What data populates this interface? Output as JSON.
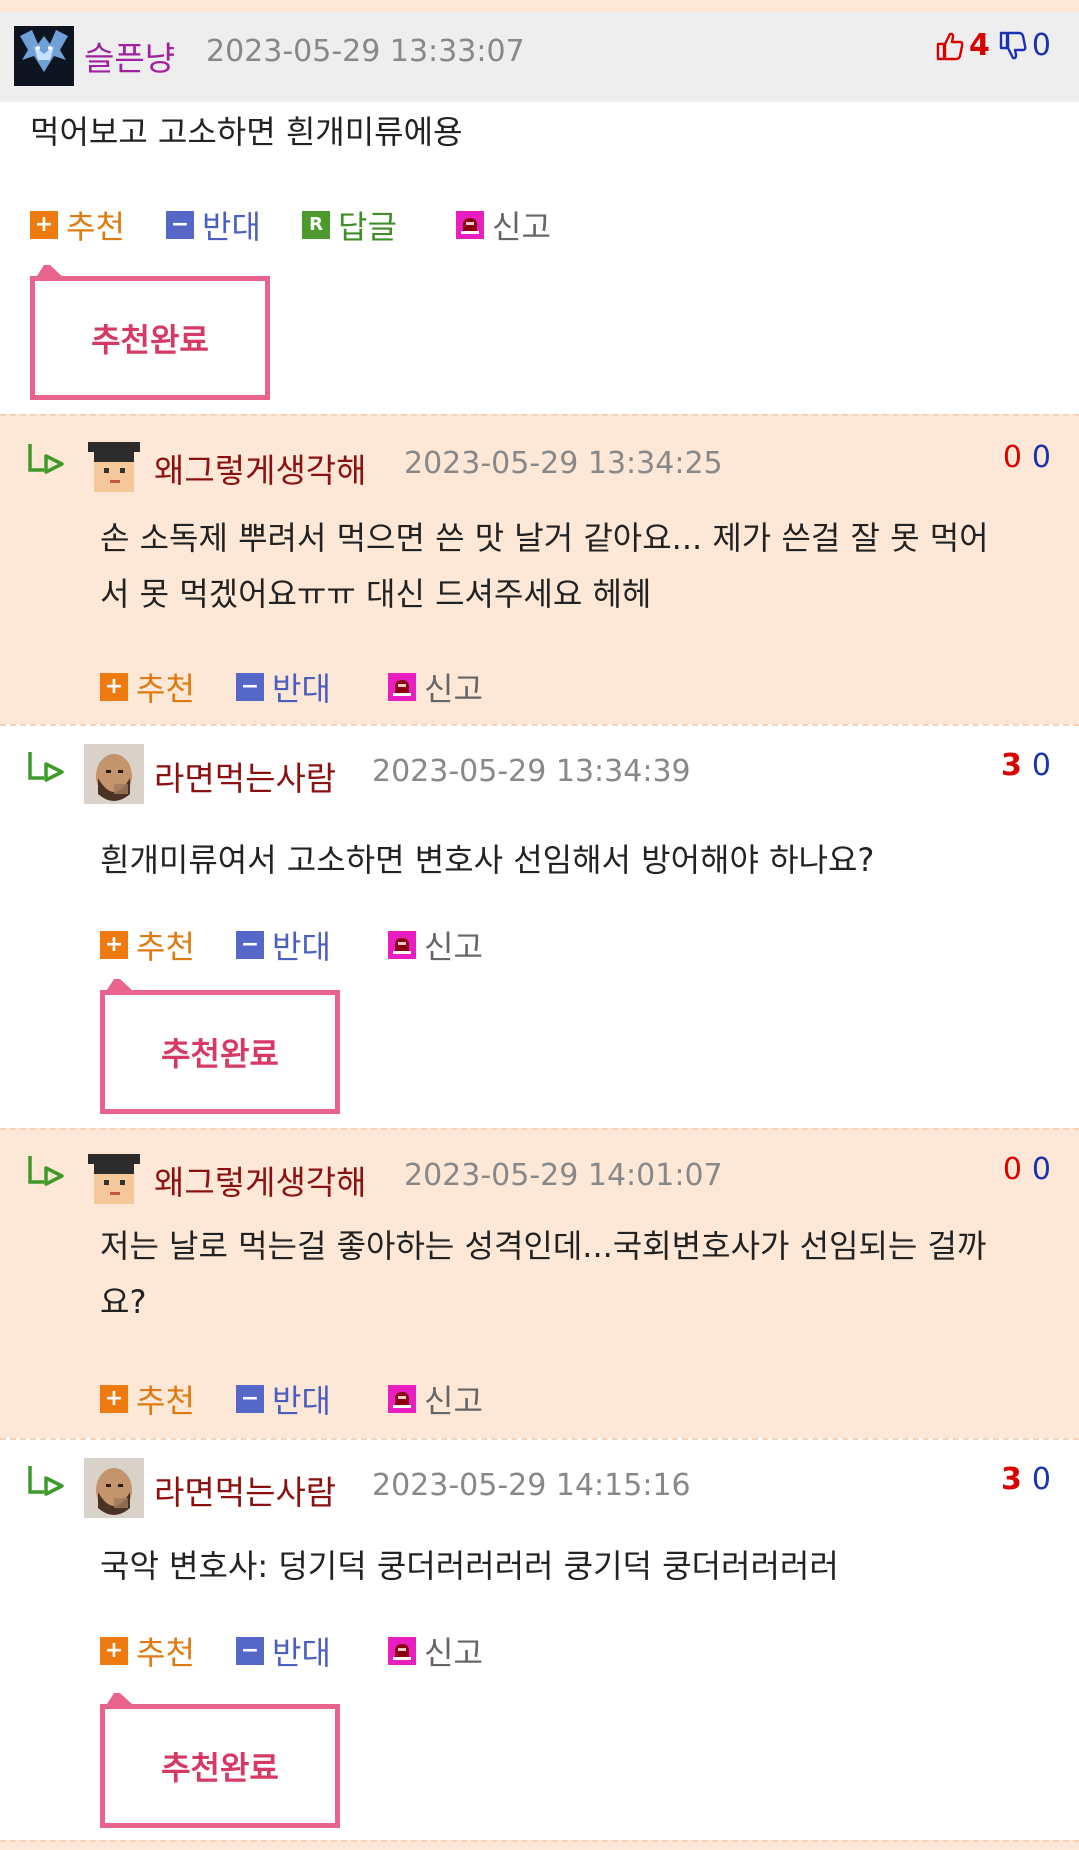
{
  "comments": [
    {
      "nick": "슬픈냥",
      "time": "2023-05-29 13:33:07",
      "up": "4",
      "down": "0",
      "text": "먹어보고 고소하면 흰개미류에용",
      "actions": {
        "recommend": "추천",
        "oppose": "반대",
        "reply": "답글",
        "report": "신고"
      },
      "done": "추천완료"
    },
    {
      "nick": "왜그렇게생각해",
      "time": "2023-05-29 13:34:25",
      "up": "0",
      "down": "0",
      "text_line1": "손 소독제 뿌려서 먹으면 쓴 맛 날거 같아요... 제가 쓴걸 잘 못 먹어",
      "text_line2": "서 못 먹겠어요ㅠㅠ 대신 드셔주세요 헤헤",
      "actions": {
        "recommend": "추천",
        "oppose": "반대",
        "report": "신고"
      }
    },
    {
      "nick": "라면먹는사람",
      "time": "2023-05-29 13:34:39",
      "up": "3",
      "down": "0",
      "text": "흰개미류여서 고소하면 변호사 선임해서 방어해야 하나요?",
      "actions": {
        "recommend": "추천",
        "oppose": "반대",
        "report": "신고"
      },
      "done": "추천완료"
    },
    {
      "nick": "왜그렇게생각해",
      "time": "2023-05-29 14:01:07",
      "up": "0",
      "down": "0",
      "text_line1": "저는 날로 먹는걸 좋아하는 성격인데...국회변호사가 선임되는 걸까",
      "text_line2": "요?",
      "actions": {
        "recommend": "추천",
        "oppose": "반대",
        "report": "신고"
      }
    },
    {
      "nick": "라면먹는사람",
      "time": "2023-05-29 14:15:16",
      "up": "3",
      "down": "0",
      "text": "국악 변호사: 덩기덕 쿵더러러러러 쿵기덕 쿵더러러러러",
      "actions": {
        "recommend": "추천",
        "oppose": "반대",
        "report": "신고"
      },
      "done": "추천완료"
    }
  ],
  "colors": {
    "peach_bg": "#fde8d8",
    "header_gray": "#eeeeee",
    "nick_purple": "#a020a0",
    "nick_maroon": "#8b1010",
    "upvote_red": "#d90000",
    "downvote_blue": "#1a33b3",
    "done_pink": "#e8648c"
  },
  "icons": {
    "reply_arrow": "reply-arrow-icon",
    "thumbs_up": "thumbs-up-icon",
    "thumbs_down": "thumbs-down-icon",
    "plus": "plus-icon",
    "minus": "minus-icon",
    "reply_r": "r-icon",
    "siren": "siren-icon"
  }
}
